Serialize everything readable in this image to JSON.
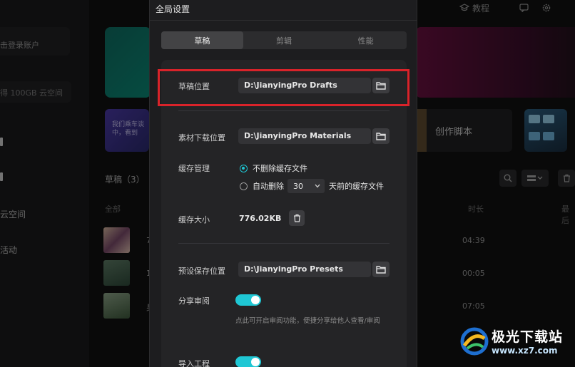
{
  "background": {
    "sidebar": {
      "login_text": "击登录账户",
      "storage_text": "得 100GB 云空间",
      "nav_items": [
        "",
        "",
        "云空间",
        "活动"
      ]
    },
    "topbar": {
      "tutorial": "教程"
    },
    "card_promo_text": "我们乘车谈中，看到",
    "card_script_label": "创作脚本",
    "drafts_title": "草稿（3）",
    "list_headers": {
      "all": "全部",
      "duration": "时长",
      "last": "最后"
    },
    "durations": [
      "04:39",
      "00:05",
      "07:05"
    ],
    "row_prefixes": [
      "7",
      "1",
      "身"
    ]
  },
  "dialog": {
    "title": "全局设置",
    "tabs": [
      {
        "label": "草稿",
        "active": true
      },
      {
        "label": "剪辑",
        "active": false
      },
      {
        "label": "性能",
        "active": false
      }
    ],
    "draft_location": {
      "label": "草稿位置",
      "value": "D:\\JianyingPro Drafts"
    },
    "material_download": {
      "label": "素材下载位置",
      "value": "D:\\JianyingPro Materials"
    },
    "cache": {
      "label": "缓存管理",
      "option_keep": "不删除缓存文件",
      "option_auto_prefix": "自动删除",
      "days": "30",
      "option_auto_suffix": "天前的缓存文件",
      "selected": "keep"
    },
    "cache_size": {
      "label": "缓存大小",
      "value": "776.02KB"
    },
    "preset_location": {
      "label": "预设保存位置",
      "value": "D:\\JianyingPro Presets"
    },
    "share_review": {
      "label": "分享审阅",
      "enabled": true,
      "hint": "点此可开启审阅功能，便捷分享给他人查看/审阅"
    },
    "import_project": {
      "label": "导入工程",
      "enabled": true
    }
  },
  "highlight_color": "#d9232a",
  "accent_color": "#1fc7d4",
  "watermark": {
    "cn": "极光下载站",
    "url": "www.xz7.com"
  }
}
